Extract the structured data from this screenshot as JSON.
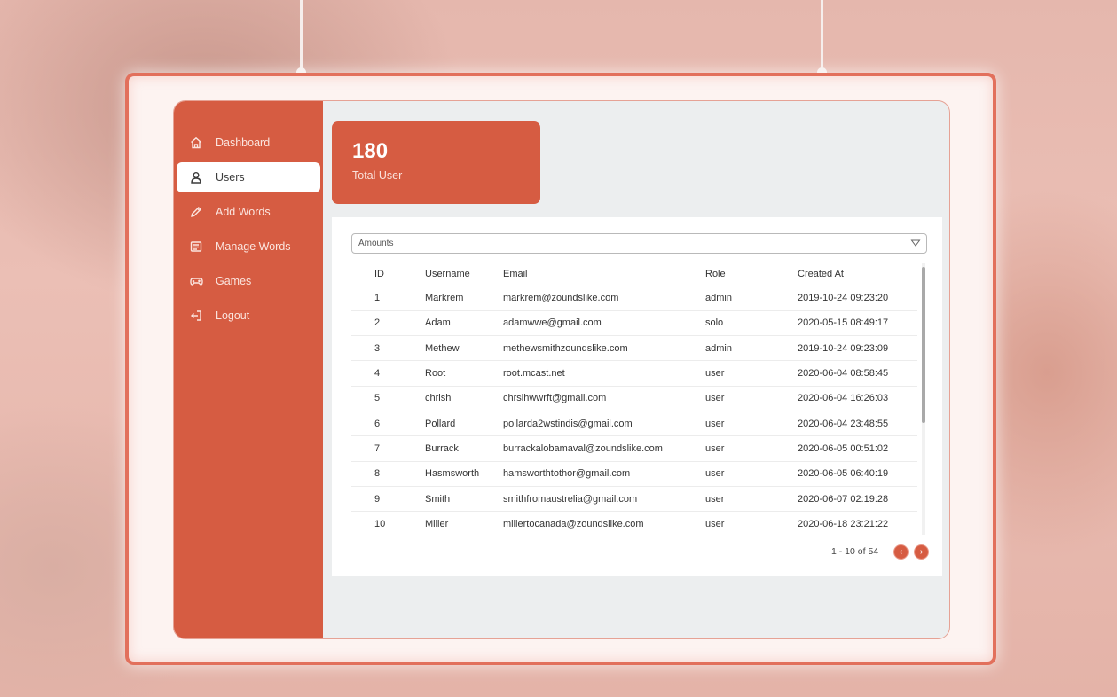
{
  "sidebar": {
    "items": [
      {
        "label": "Dashboard",
        "icon": "home-icon"
      },
      {
        "label": "Users",
        "icon": "user-icon",
        "active": true
      },
      {
        "label": "Add Words",
        "icon": "pencil-icon"
      },
      {
        "label": "Manage Words",
        "icon": "list-icon"
      },
      {
        "label": "Games",
        "icon": "gamepad-icon"
      },
      {
        "label": "Logout",
        "icon": "logout-icon"
      }
    ]
  },
  "stat": {
    "value": "180",
    "label": "Total User"
  },
  "filter": {
    "selected": "Amounts"
  },
  "table": {
    "headers": [
      "ID",
      "Username",
      "Email",
      "Role",
      "Created At"
    ],
    "rows": [
      [
        "1",
        "Markrem",
        "markrem@zoundslike.com",
        "admin",
        "2019-10-24 09:23:20"
      ],
      [
        "2",
        "Adam",
        "adamwwe@gmail.com",
        "solo",
        "2020-05-15 08:49:17"
      ],
      [
        "3",
        "Methew",
        "methewsmithzoundslike.com",
        "admin",
        "2019-10-24 09:23:09"
      ],
      [
        "4",
        "Root",
        "root.mcast.net",
        "user",
        "2020-06-04 08:58:45"
      ],
      [
        "5",
        "chrish",
        "chrsihwwrft@gmail.com",
        "user",
        "2020-06-04 16:26:03"
      ],
      [
        "6",
        "Pollard",
        "pollarda2wstindis@gmail.com",
        "user",
        "2020-06-04 23:48:55"
      ],
      [
        "7",
        "Burrack",
        "burrackalobamaval@zoundslike.com",
        "user",
        "2020-06-05 00:51:02"
      ],
      [
        "8",
        "Hasmsworth",
        "hamsworthtothor@gmail.com",
        "user",
        "2020-06-05 06:40:19"
      ],
      [
        "9",
        "Smith",
        "smithfromaustrelia@gmail.com",
        "user",
        "2020-06-07 02:19:28"
      ],
      [
        "10",
        "Miller",
        "millertocanada@zoundslike.com",
        "user",
        "2020-06-18 23:21:22"
      ]
    ]
  },
  "pagination": {
    "text": "1 - 10 of 54",
    "prev": "‹",
    "next": "›"
  },
  "colors": {
    "accent": "#d65c42",
    "frame": "#e2705c"
  }
}
